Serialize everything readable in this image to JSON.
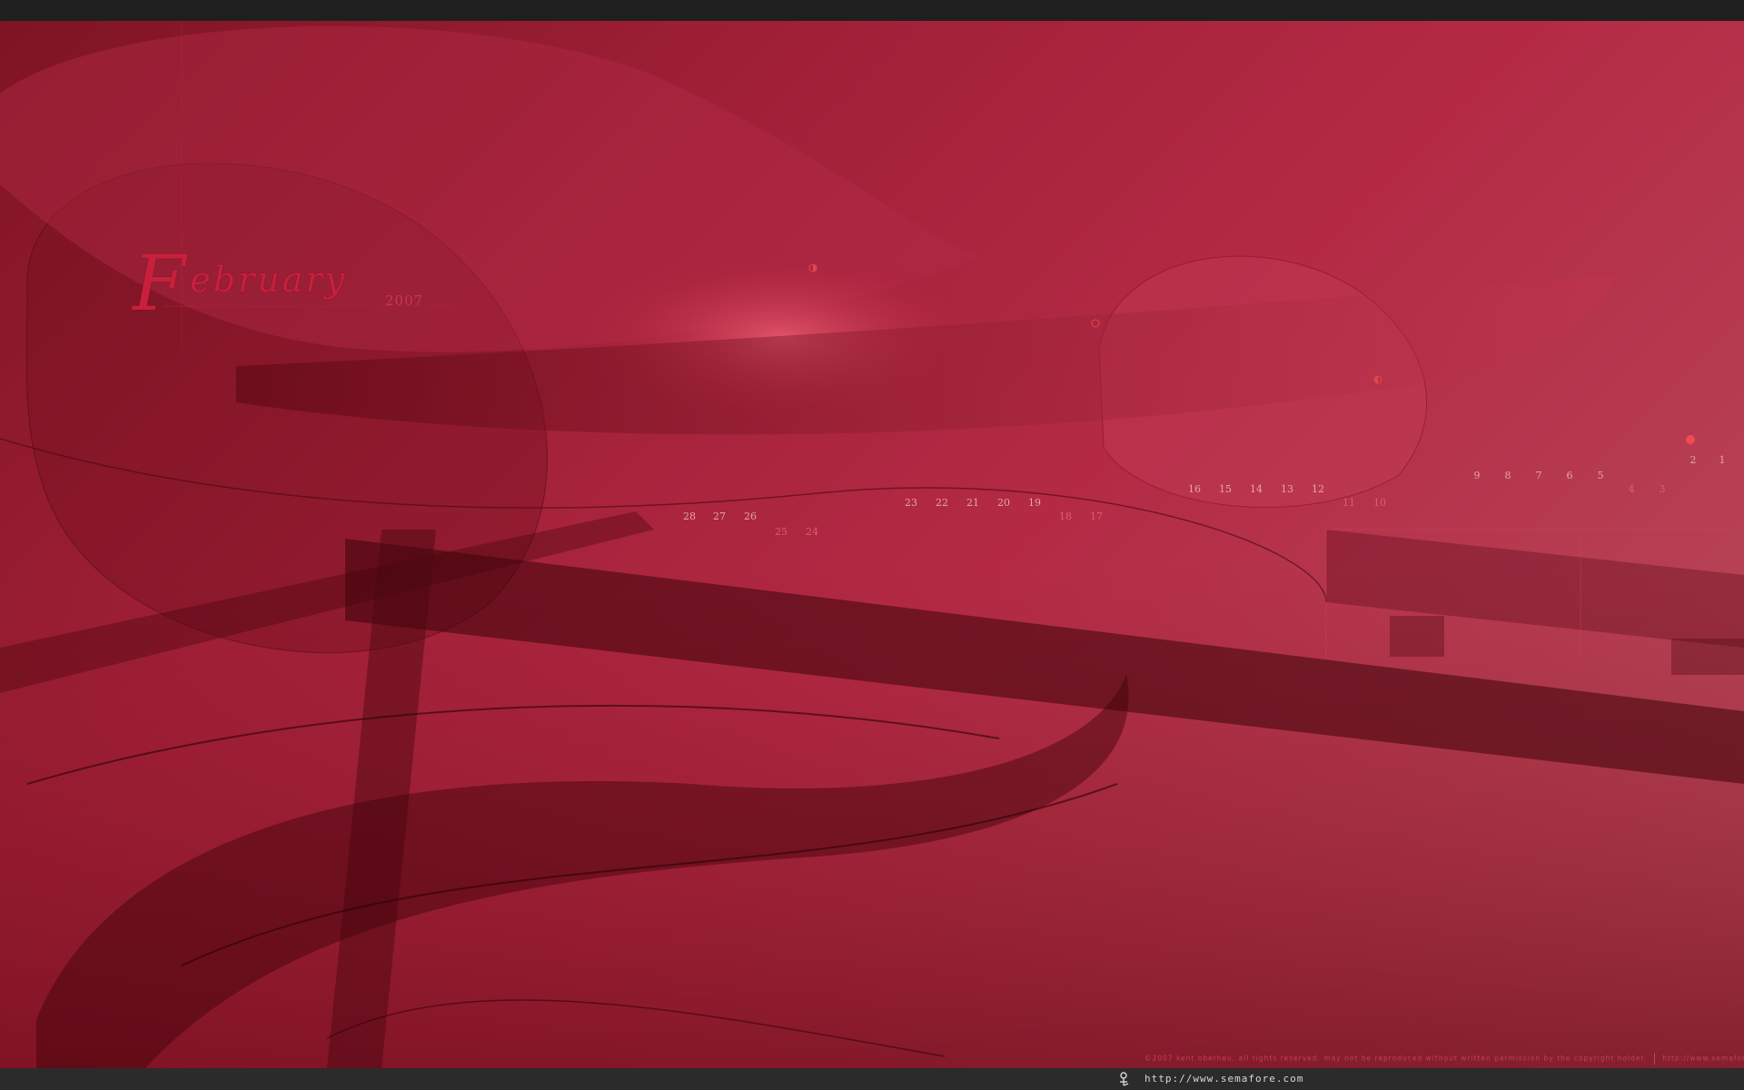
{
  "calendar": {
    "month_first_letter": "F",
    "month_rest": "ebruary",
    "year": "2007",
    "days": [
      {
        "n": "28",
        "weekend": false
      },
      {
        "n": "27",
        "weekend": false
      },
      {
        "n": "26",
        "weekend": false
      },
      {
        "n": "25",
        "weekend": true
      },
      {
        "n": "24",
        "weekend": true
      },
      {
        "n": "23",
        "weekend": false
      },
      {
        "n": "22",
        "weekend": false
      },
      {
        "n": "21",
        "weekend": false
      },
      {
        "n": "20",
        "weekend": false
      },
      {
        "n": "19",
        "weekend": false
      },
      {
        "n": "18",
        "weekend": true
      },
      {
        "n": "17",
        "weekend": true
      },
      {
        "n": "16",
        "weekend": false
      },
      {
        "n": "15",
        "weekend": false
      },
      {
        "n": "14",
        "weekend": false
      },
      {
        "n": "13",
        "weekend": false
      },
      {
        "n": "12",
        "weekend": false
      },
      {
        "n": "11",
        "weekend": true
      },
      {
        "n": "10",
        "weekend": true
      },
      {
        "n": "9",
        "weekend": false
      },
      {
        "n": "8",
        "weekend": false
      },
      {
        "n": "7",
        "weekend": false
      },
      {
        "n": "6",
        "weekend": false
      },
      {
        "n": "5",
        "weekend": false
      },
      {
        "n": "4",
        "weekend": true
      },
      {
        "n": "3",
        "weekend": true
      },
      {
        "n": "2",
        "weekend": false
      },
      {
        "n": "1",
        "weekend": false
      }
    ],
    "moon_phases": [
      "first-quarter-moon-icon",
      "full-moon-icon",
      "last-quarter-moon-icon",
      "new-moon-icon"
    ]
  },
  "footer": {
    "copyright": "©2007 kent oberheu. all rights reserved. may not be reproduced without written permission by the copyright holder.",
    "site": "http://www.semafore.com"
  },
  "statusbar": {
    "icon": "semafore-logo-icon",
    "url": "http://www.semafore.com"
  },
  "colors": {
    "accent": "#c8203c",
    "moon": "#e0474d",
    "background_dark": "#7e1422",
    "background_light": "#b8505f"
  }
}
